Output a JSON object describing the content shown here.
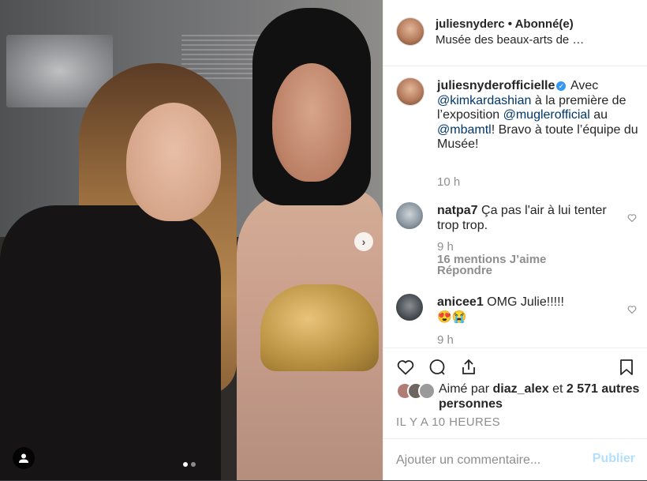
{
  "post": {
    "username": "juliesnyderofficielle",
    "header_username": "juliesnyderc",
    "follow_label": "• Abonné(e)",
    "location": "Musée des beaux-arts de …",
    "caption_parts": {
      "t1": "Avec",
      "m1": "@kimkardashian",
      "t2": "à la première de l’exposition",
      "m2": "@muglerofficial",
      "t3": "au",
      "m3": "@mbamtl",
      "t4": "! Bravo à toute l’équipe du Musée!"
    },
    "caption_time": "10 h",
    "timestamp": "IL Y A 10 HEURES"
  },
  "comments": [
    {
      "username": "natpa7",
      "text": "Ça pas l'air à lui tenter trop trop.",
      "time": "9 h",
      "likes": "16 mentions J’aime",
      "reply": "Répondre"
    },
    {
      "username": "anicee1",
      "text": "OMG Julie!!!!!",
      "emojis": "😍😭",
      "time": "9 h"
    }
  ],
  "likes": {
    "prefix": "Aimé par",
    "user": "diaz_alex",
    "mid": "et",
    "count": "2 571 autres personnes"
  },
  "add_comment": {
    "placeholder": "Ajouter un commentaire...",
    "publish_label": "Publier"
  },
  "colors": {
    "link": "#00376b",
    "verified": "#3897f0",
    "muted": "#8e8e8e",
    "publish_disabled": "#b2dffc"
  }
}
